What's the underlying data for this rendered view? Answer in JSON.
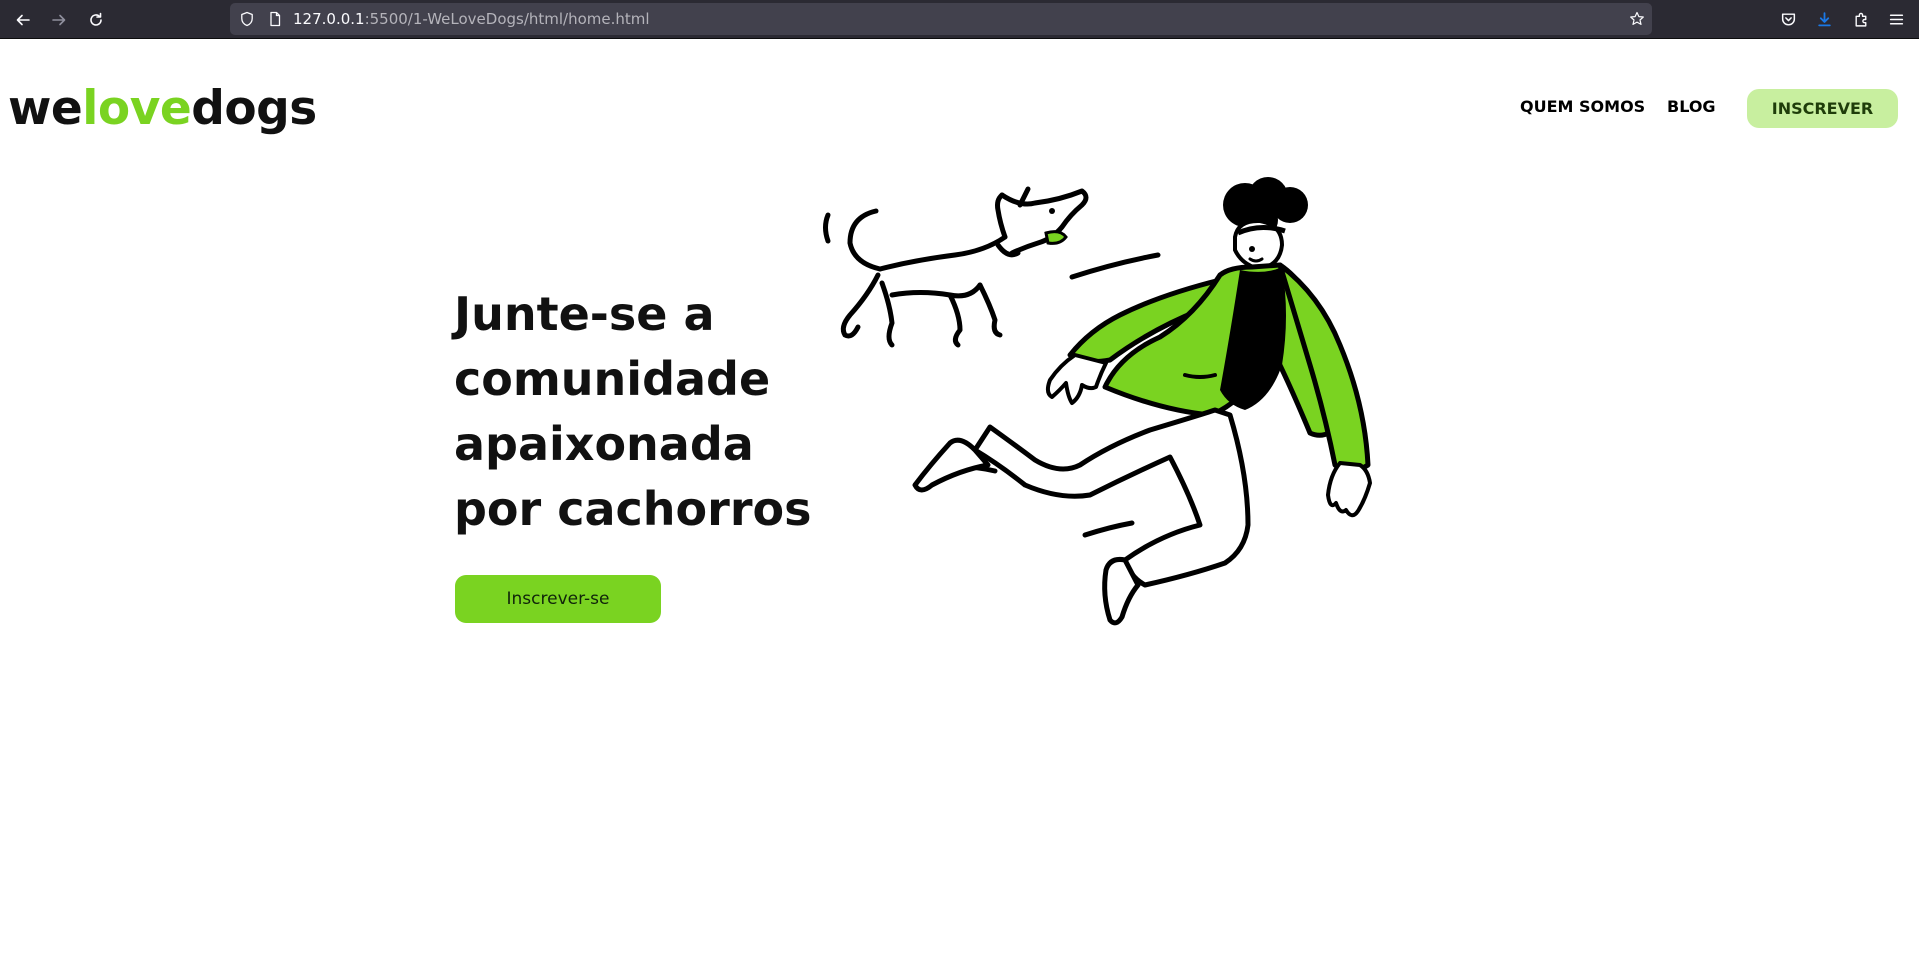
{
  "browser": {
    "url_host": "127.0.0.1",
    "url_rest": ":5500/1-WeLoveDogs/html/home.html",
    "icons": {
      "back": "arrow-left-icon",
      "forward": "arrow-right-icon",
      "reload": "reload-icon",
      "shield": "shield-icon",
      "page": "page-icon",
      "bookmark": "star-icon",
      "pocket": "pocket-icon",
      "downloads": "download-icon",
      "extensions": "puzzle-icon",
      "menu": "hamburger-menu-icon"
    }
  },
  "header": {
    "logo": {
      "part1": "we",
      "part2": "love",
      "part3": "dogs"
    },
    "nav": {
      "about": "QUEM SOMOS",
      "blog": "BLOG",
      "signup": "INSCREVER"
    }
  },
  "hero": {
    "title": "Junte-se a comunidade apaixonada por cachorros",
    "button": "Inscrever-se"
  },
  "colors": {
    "accent": "#7ad321",
    "accent_light": "#c8ef9f",
    "text": "#111111",
    "chrome": "#2b2a33",
    "urlbar": "#42414d"
  }
}
